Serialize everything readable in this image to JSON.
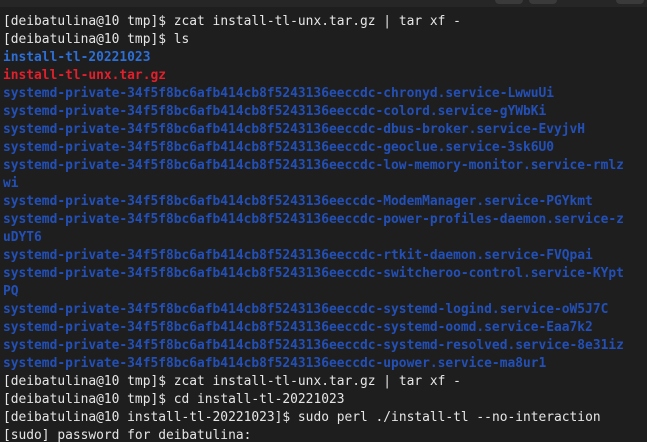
{
  "terminal": {
    "lines": [
      {
        "kind": "prompt",
        "prompt": "[deibatulina@10 tmp]$ ",
        "command": "zcat install-tl-unx.tar.gz | tar xf -"
      },
      {
        "kind": "prompt",
        "prompt": "[deibatulina@10 tmp]$ ",
        "command": "ls"
      },
      {
        "kind": "dir",
        "text": "install-tl-20221023"
      },
      {
        "kind": "archive",
        "text": "install-tl-unx.tar.gz"
      },
      {
        "kind": "sysdir",
        "text": "systemd-private-34f5f8bc6afb414cb8f5243136eeccdc-chronyd.service-LwwuUi"
      },
      {
        "kind": "sysdir",
        "text": "systemd-private-34f5f8bc6afb414cb8f5243136eeccdc-colord.service-gYWbKi"
      },
      {
        "kind": "sysdir",
        "text": "systemd-private-34f5f8bc6afb414cb8f5243136eeccdc-dbus-broker.service-EvyjvH"
      },
      {
        "kind": "sysdir",
        "text": "systemd-private-34f5f8bc6afb414cb8f5243136eeccdc-geoclue.service-3sk6U0"
      },
      {
        "kind": "sysdir",
        "text": "systemd-private-34f5f8bc6afb414cb8f5243136eeccdc-low-memory-monitor.service-rmlz"
      },
      {
        "kind": "sysdir",
        "text": "wi"
      },
      {
        "kind": "sysdir",
        "text": "systemd-private-34f5f8bc6afb414cb8f5243136eeccdc-ModemManager.service-PGYkmt"
      },
      {
        "kind": "sysdir",
        "text": "systemd-private-34f5f8bc6afb414cb8f5243136eeccdc-power-profiles-daemon.service-z"
      },
      {
        "kind": "sysdir",
        "text": "uDYT6"
      },
      {
        "kind": "sysdir",
        "text": "systemd-private-34f5f8bc6afb414cb8f5243136eeccdc-rtkit-daemon.service-FVQpai"
      },
      {
        "kind": "sysdir",
        "text": "systemd-private-34f5f8bc6afb414cb8f5243136eeccdc-switcheroo-control.service-KYpt"
      },
      {
        "kind": "sysdir",
        "text": "PQ"
      },
      {
        "kind": "sysdir",
        "text": "systemd-private-34f5f8bc6afb414cb8f5243136eeccdc-systemd-logind.service-oW5J7C"
      },
      {
        "kind": "sysdir",
        "text": "systemd-private-34f5f8bc6afb414cb8f5243136eeccdc-systemd-oomd.service-Eaa7k2"
      },
      {
        "kind": "sysdir",
        "text": "systemd-private-34f5f8bc6afb414cb8f5243136eeccdc-systemd-resolved.service-8e31iz"
      },
      {
        "kind": "sysdir",
        "text": "systemd-private-34f5f8bc6afb414cb8f5243136eeccdc-upower.service-ma8ur1"
      },
      {
        "kind": "prompt",
        "prompt": "[deibatulina@10 tmp]$ ",
        "command": "zcat install-tl-unx.tar.gz | tar xf -"
      },
      {
        "kind": "prompt",
        "prompt": "[deibatulina@10 tmp]$ ",
        "command": "cd install-tl-20221023"
      },
      {
        "kind": "prompt",
        "prompt": "[deibatulina@10 install-tl-20221023]$ ",
        "command": "sudo perl ./install-tl --no-interaction"
      },
      {
        "kind": "partial",
        "text": "[sudo] password for deibatulina:"
      }
    ]
  },
  "colors": {
    "background": "#1e1e1e",
    "text": "#e6e6e6",
    "directory": "#2d6fd6",
    "archive": "#e0202c",
    "systemd_dir": "#2350b8"
  }
}
